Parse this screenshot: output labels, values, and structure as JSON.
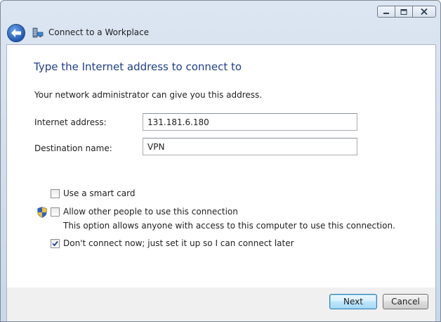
{
  "window": {
    "minimize_icon": "minimize-icon",
    "maximize_icon": "maximize-icon",
    "close_icon": "close-icon"
  },
  "nav": {
    "back_icon": "back-arrow-icon",
    "wizard_icon": "workplace-network-icon",
    "wizard_title": "Connect to a Workplace"
  },
  "page": {
    "heading": "Type the Internet address to connect to",
    "intro": "Your network administrator can give you this address."
  },
  "form": {
    "internet_address_label": "Internet address:",
    "internet_address_value": "131.181.6.180",
    "destination_name_label": "Destination name:",
    "destination_name_value": "VPN"
  },
  "options": {
    "smart_card_label": "Use a smart card",
    "smart_card_checked": false,
    "allow_others_label": "Allow other people to use this connection",
    "allow_others_checked": false,
    "allow_others_note": "This option allows anyone with access to this computer to use this connection.",
    "allow_others_icon": "uac-shield-icon",
    "dont_connect_label": "Don't connect now; just set it up so I can connect later",
    "dont_connect_checked": true
  },
  "footer": {
    "next_label": "Next",
    "cancel_label": "Cancel"
  },
  "colors": {
    "heading": "#1e3f8a",
    "accent_button_border": "#3c7fb1"
  }
}
